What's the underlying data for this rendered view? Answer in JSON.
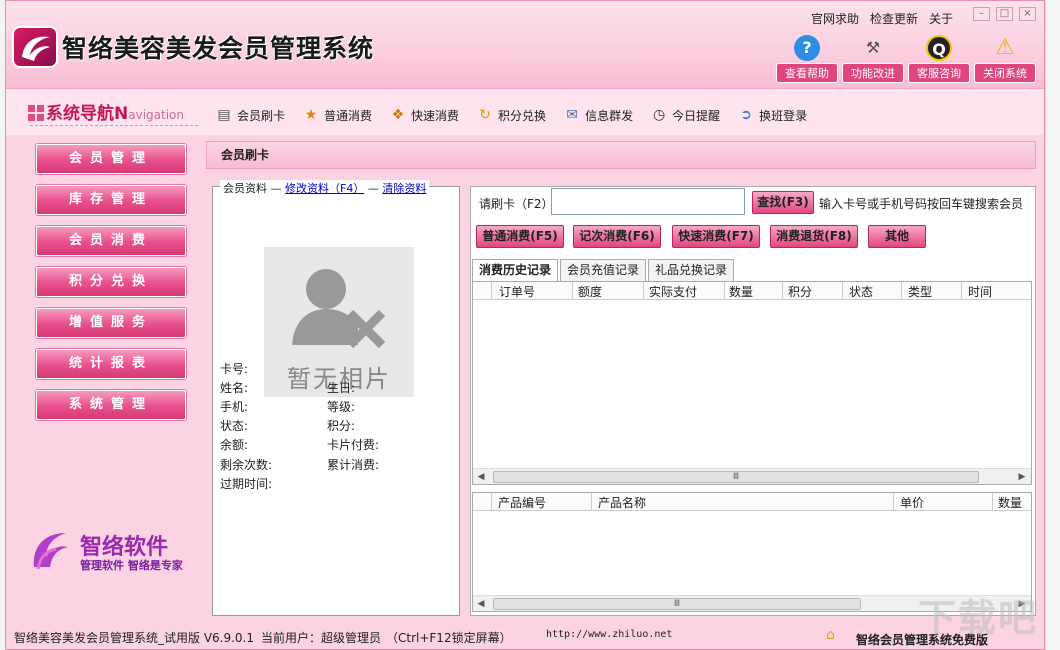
{
  "window": {
    "app_title": "智络美容美发会员管理系统",
    "top_links": [
      "官网求助",
      "检查更新",
      "关于"
    ],
    "help_buttons": [
      {
        "label": "查看帮助",
        "icon": "help-icon"
      },
      {
        "label": "功能改进",
        "icon": "tools-icon"
      },
      {
        "label": "客服咨询",
        "icon": "qq-icon"
      },
      {
        "label": "关闭系统",
        "icon": "warning-icon"
      }
    ]
  },
  "nav": {
    "title": "系统导航",
    "title_en_first": "N",
    "title_en_rest": "avigation"
  },
  "toolbar": [
    "会员刷卡",
    "普通消费",
    "快速消费",
    "积分兑换",
    "信息群发",
    "今日提醒",
    "换班登录"
  ],
  "sidebar": [
    "会员管理",
    "库存管理",
    "会员消费",
    "积分兑换",
    "增值服务",
    "统计报表",
    "系统管理"
  ],
  "brand": {
    "name": "智络软件",
    "slogan": "管理软件 智络是专家"
  },
  "panel": {
    "title": "会员刷卡"
  },
  "member": {
    "legend_title": "会员资料",
    "edit_link": "修改资料（F4）",
    "clear_link": "清除资料",
    "photo_caption": "暂无相片",
    "fields_left": [
      "卡号:",
      "姓名:",
      "手机:",
      "状态:",
      "余额:",
      "剩余次数:",
      "过期时间:"
    ],
    "fields_right": [
      "生日:",
      "等级:",
      "积分:",
      "卡片付费:",
      "累计消费:"
    ]
  },
  "search": {
    "label": "请刷卡（F2）:",
    "value": "",
    "find_button": "查找(F3)",
    "hint": "输入卡号或手机号码按回车键搜索会员"
  },
  "actions": [
    "普通消费(F5)",
    "记次消费(F6)",
    "快速消费(F7)",
    "消费退货(F8)",
    "其他"
  ],
  "tabs": [
    "消费历史记录",
    "会员充值记录",
    "礼品兑换记录"
  ],
  "history_columns": [
    "订单号",
    "额度",
    "实际支付",
    "数量",
    "积分",
    "状态",
    "类型",
    "时间"
  ],
  "product_columns": [
    "产品编号",
    "产品名称",
    "单价",
    "数量"
  ],
  "scroll_mark": "Ⅲ",
  "status": {
    "app": "智络美容美发会员管理系统_试用版 V6.9.0.1",
    "user": "当前用户：超级管理员",
    "lock_hint": "（Ctrl+F12锁定屏幕）",
    "url": "http://www.zhiluo.net",
    "edition": "智络会员管理系统免费版"
  },
  "watermark": "下载吧",
  "colors": {
    "accent": "#e84f8b",
    "background": "#fbd3e2",
    "link": "#0000cc"
  }
}
